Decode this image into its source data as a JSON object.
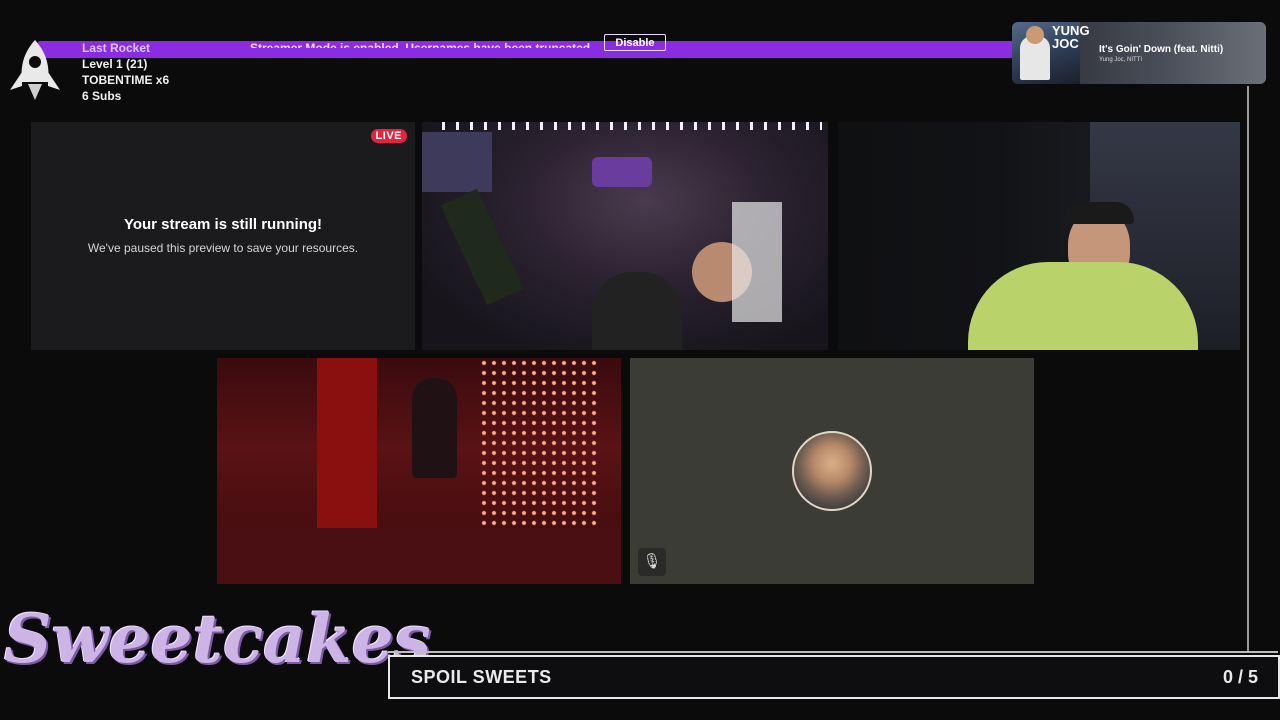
{
  "banner": {
    "text": "Streamer Mode is enabled. Usernames have been truncated.",
    "button_label": "Disable"
  },
  "stats": {
    "last_label": "Last Rocket",
    "level": "Level 1  (21)",
    "top": "TOBENTIME x6",
    "subs": "6 Subs"
  },
  "now_playing": {
    "title": "It's Goin' Down (feat. Nitti)",
    "artist": "Yung Joc, NITTI",
    "art_text": "YUNG JOC"
  },
  "preview": {
    "badge": "LIVE",
    "heading": "Your stream is still running!",
    "subtext": "We've paused this preview to save your resources."
  },
  "goal": {
    "title": "SPOIL SWEETS",
    "count": "0 / 5"
  },
  "brand": {
    "logo_text": "Sweetcakes"
  },
  "icons": {
    "rocket": "rocket-icon",
    "mute": "mic-muted-icon"
  },
  "colors": {
    "banner": "#8b2be2",
    "live": "#e0263f",
    "logo": "#cdb4e6"
  }
}
